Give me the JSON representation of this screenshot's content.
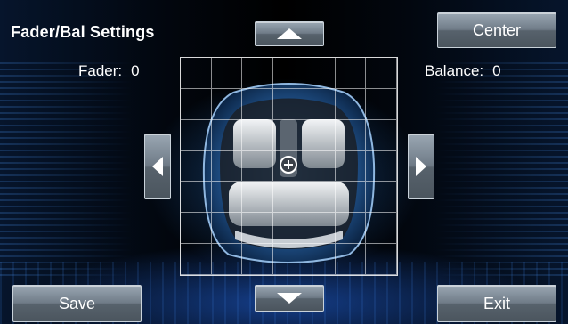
{
  "title": "Fader/Bal Settings",
  "fader": {
    "label": "Fader:",
    "value": "0"
  },
  "balance": {
    "label": "Balance:",
    "value": "0"
  },
  "buttons": {
    "center": "Center",
    "save": "Save",
    "exit": "Exit"
  },
  "icons": {
    "up": "up-arrow-icon",
    "down": "down-arrow-icon",
    "left": "left-arrow-icon",
    "right": "right-arrow-icon",
    "crosshair": "crosshair-icon"
  },
  "colors": {
    "background_glow": "#1e5ac8",
    "button_top": "#9aa7b3",
    "button_bottom": "#4b555e",
    "text": "#ffffff"
  }
}
